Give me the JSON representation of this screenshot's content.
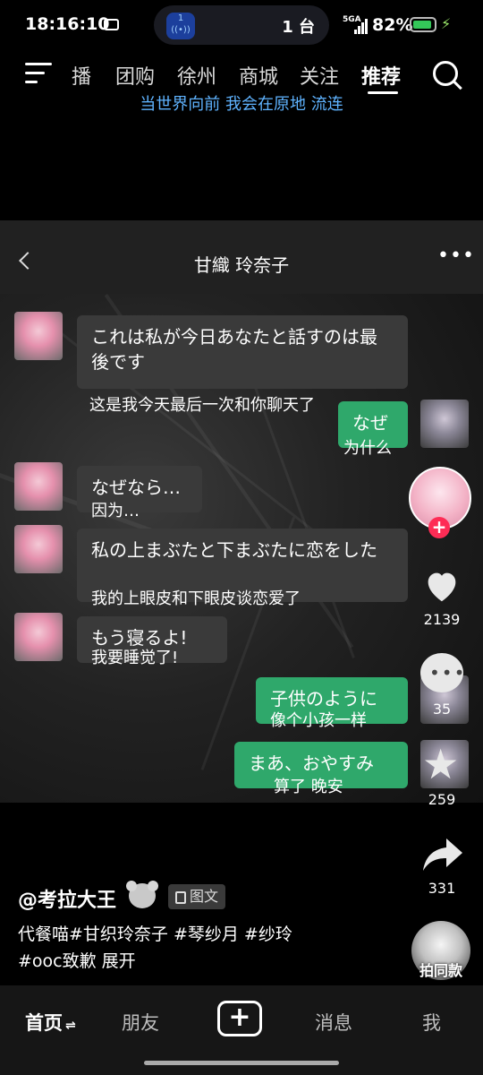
{
  "status_bar": {
    "time": "18:16:10",
    "network": "5GA",
    "battery": "82%",
    "island_badge": "1",
    "island_count": "1 台"
  },
  "top_nav": {
    "tabs": [
      "播",
      "团购",
      "徐州",
      "商城",
      "关注",
      "推荐"
    ],
    "active": "推荐",
    "lyric": "当世界向前 我会在原地 流连"
  },
  "chat_header": {
    "title": "甘織 玲奈子",
    "more": "•••"
  },
  "messages": [
    {
      "side": "left",
      "text": "これは私が今日あなたと話すのは最後です",
      "translation": "这是我今天最后一次和你聊天了"
    },
    {
      "side": "right",
      "text": "なぜ",
      "translation": "为什么"
    },
    {
      "side": "left",
      "text": "なぜなら…",
      "translation": "因为…"
    },
    {
      "side": "left",
      "text": "私の上まぶたと下まぶたに恋をした",
      "translation": "我的上眼皮和下眼皮谈恋爱了"
    },
    {
      "side": "left",
      "text": "もう寝るよ!",
      "translation": "我要睡觉了!"
    },
    {
      "side": "right",
      "text": "子供のように",
      "translation": "像个小孩一样"
    },
    {
      "side": "right",
      "text": "まあ、おやすみ",
      "translation": "算了 晚安"
    }
  ],
  "actions": {
    "likes": "2139",
    "comments": "35",
    "favorites": "259",
    "shares": "331"
  },
  "caption": {
    "author": "@考拉大王",
    "type_tag": "图文",
    "line1": "代餐喵#甘织玲奈子 #琴纱月 #纱玲",
    "line2": "#ooc致歉 展开",
    "same_style": "拍同款"
  },
  "bottom_nav": {
    "home": "首页",
    "home_arrow": "⇌",
    "friends": "朋友",
    "add": "+",
    "messages": "消息",
    "me": "我"
  },
  "colors": {
    "bubble_left": "#3a3a3a",
    "bubble_right": "#2fa86b",
    "lyric": "#5fb3ff",
    "follow_plus": "#fe2c55"
  }
}
